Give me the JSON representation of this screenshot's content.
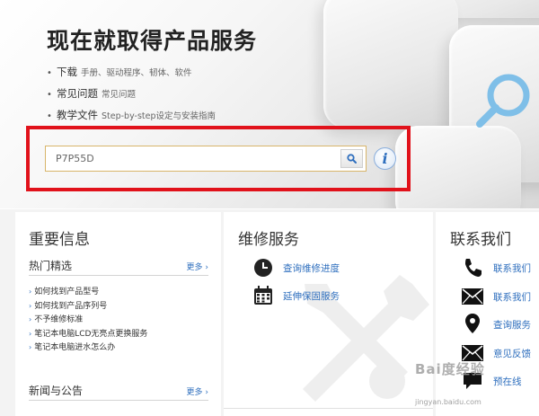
{
  "hero": {
    "title": "现在就取得产品服务",
    "items": [
      {
        "main": "下载",
        "sub": "手册、驱动程序、韧体、软件"
      },
      {
        "main": "常见问题",
        "sub": "常见问题"
      },
      {
        "main": "教学文件",
        "sub": "Step-by-step设定与安装指南"
      }
    ]
  },
  "search": {
    "value": "P7P55D",
    "button_icon": "search-icon",
    "info_icon": "info-icon"
  },
  "important": {
    "title": "重要信息",
    "hot": {
      "label": "热门精选",
      "more": "更多 ›"
    },
    "links": [
      "如何找到产品型号",
      "如何找到产品序列号",
      "不予维修标准",
      "笔记本电脑LCD无亮点更换服务",
      "笔记本电脑进水怎么办"
    ],
    "news": {
      "label": "新闻与公告",
      "more": "更多 ›"
    }
  },
  "repair": {
    "title": "维修服务",
    "items": [
      {
        "label": "查询维修进度",
        "icon": "clock-icon"
      },
      {
        "label": "延伸保固服务",
        "icon": "calendar-icon"
      }
    ]
  },
  "contact": {
    "title": "联系我们",
    "items": [
      {
        "label": "联系我们",
        "icon": "phone-icon"
      },
      {
        "label": "联系我们",
        "icon": "mail-icon"
      },
      {
        "label": "查询服务",
        "icon": "map-pin-icon"
      },
      {
        "label": "意见反馈",
        "icon": "mail-icon"
      },
      {
        "label": "预在线",
        "icon": "chat-icon"
      }
    ]
  },
  "watermark": {
    "text": "Bai度经验",
    "sub": "jingyan.baidu.com"
  },
  "colors": {
    "accent": "#2f6fbe",
    "highlight": "#e1121b",
    "input_border": "#d8b56a"
  }
}
